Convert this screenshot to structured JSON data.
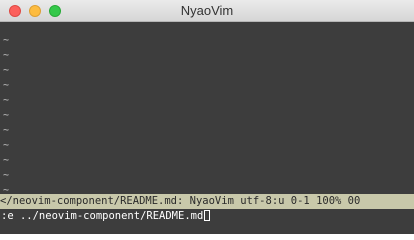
{
  "window": {
    "title": "NyaoVim"
  },
  "editor": {
    "tilde_char": "~"
  },
  "statusline": {
    "text": "</neovim-component/README.md: NyaoVim utf-8:u 0-1 100% 00"
  },
  "cmdline": {
    "text": ":e ../neovim-component/README.md"
  },
  "colors": {
    "background": "#3d3d3d",
    "statusline_bg": "#c8c8aa",
    "tilde": "#c8c8c8",
    "text": "#ffffff"
  }
}
